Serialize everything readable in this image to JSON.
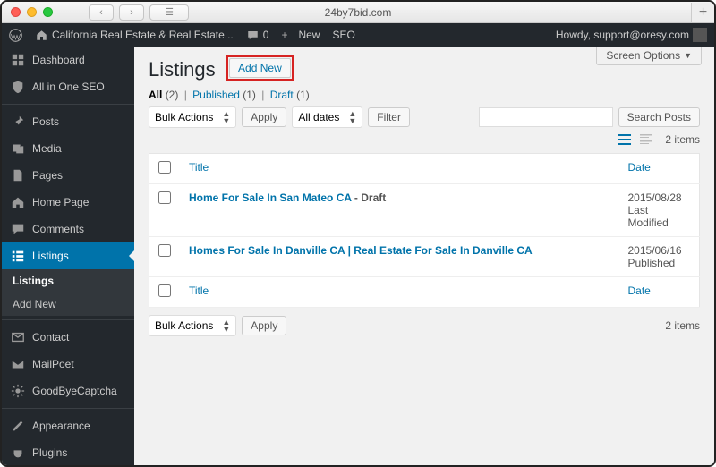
{
  "browser": {
    "title": "24by7bid.com"
  },
  "adminbar": {
    "site_name": "California Real Estate & Real Estate...",
    "comments": "0",
    "new_label": "New",
    "seo_label": "SEO",
    "howdy": "Howdy, support@oresy.com"
  },
  "sidebar": {
    "items": [
      {
        "label": "Dashboard",
        "icon": "dashboard"
      },
      {
        "label": "All in One SEO",
        "icon": "shield"
      },
      {
        "label": "Posts",
        "icon": "pin"
      },
      {
        "label": "Media",
        "icon": "media"
      },
      {
        "label": "Pages",
        "icon": "page"
      },
      {
        "label": "Home Page",
        "icon": "home"
      },
      {
        "label": "Comments",
        "icon": "comment"
      },
      {
        "label": "Listings",
        "icon": "list",
        "current": true
      },
      {
        "label": "Contact",
        "icon": "mail"
      },
      {
        "label": "MailPoet",
        "icon": "envelope"
      },
      {
        "label": "GoodByeCaptcha",
        "icon": "cog"
      },
      {
        "label": "Appearance",
        "icon": "brush"
      },
      {
        "label": "Plugins",
        "icon": "plug"
      }
    ],
    "submenu": [
      {
        "label": "Listings",
        "current": true
      },
      {
        "label": "Add New"
      }
    ]
  },
  "page": {
    "title": "Listings",
    "add_new": "Add New",
    "screen_options": "Screen Options",
    "filters": {
      "all": "All",
      "all_count": "(2)",
      "published": "Published",
      "published_count": "(1)",
      "draft": "Draft",
      "draft_count": "(1)"
    },
    "bulk_label": "Bulk Actions",
    "apply": "Apply",
    "dates_label": "All dates",
    "filter": "Filter",
    "search_btn": "Search Posts",
    "items_text": "2 items",
    "columns": {
      "title": "Title",
      "date": "Date"
    },
    "rows": [
      {
        "title": "Home For Sale In San Mateo CA",
        "state": " - Draft",
        "date": "2015/08/28",
        "status": "Last Modified"
      },
      {
        "title": "Homes For Sale In Danville CA | Real Estate For Sale In Danville CA",
        "state": "",
        "date": "2015/06/16",
        "status": "Published"
      }
    ]
  }
}
